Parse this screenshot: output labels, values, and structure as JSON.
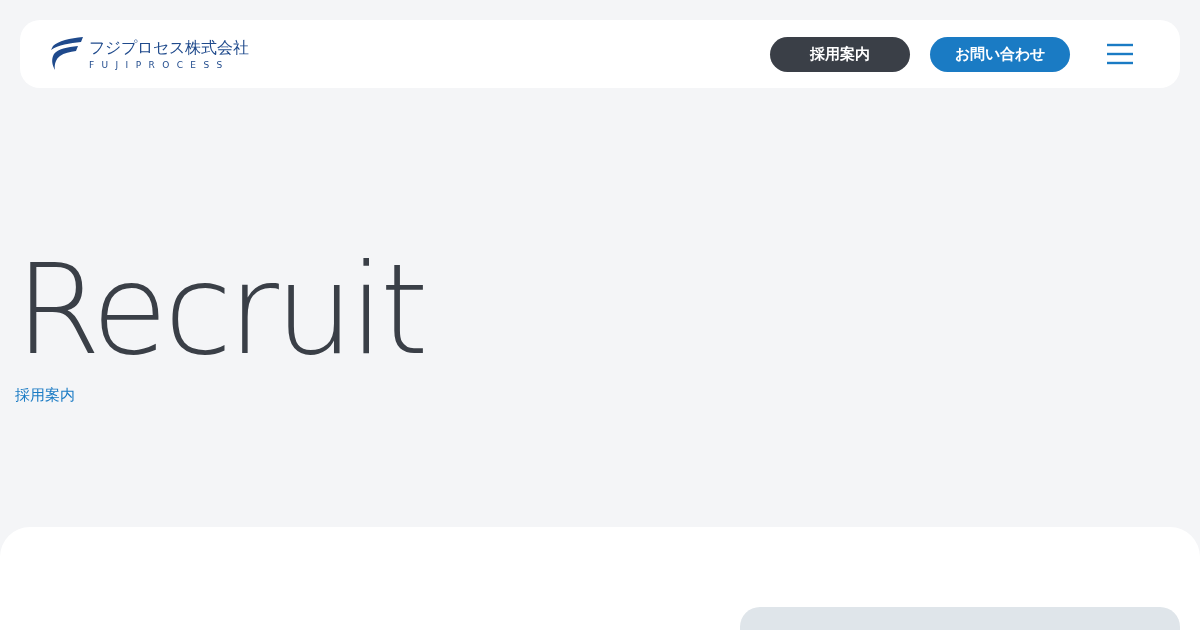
{
  "header": {
    "logo": {
      "name": "フジプロセス株式会社",
      "romaji": "FUJIPROCESS"
    },
    "buttons": [
      {
        "label": "採用案内",
        "kind": "dark"
      },
      {
        "label": "お問い合わせ",
        "kind": "primary"
      }
    ]
  },
  "hero": {
    "title": "Recruit",
    "subtitle": "採用案内"
  }
}
